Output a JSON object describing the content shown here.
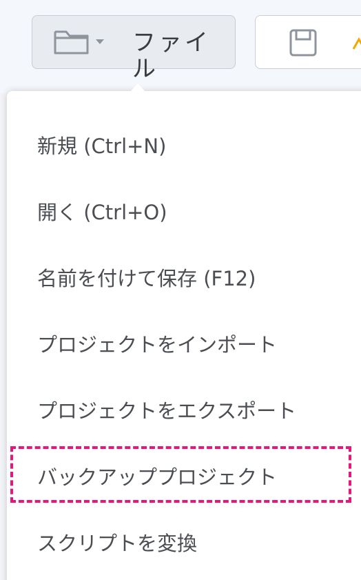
{
  "toolbar": {
    "file_button_label": "ファイル",
    "file_icon": "folder-icon",
    "save_icon": "save-icon",
    "accent_color": "#f2a900"
  },
  "file_menu": {
    "items": [
      {
        "label": "新規 (Ctrl+N)"
      },
      {
        "label": "開く (Ctrl+O)"
      },
      {
        "label": "名前を付けて保存 (F12)"
      },
      {
        "label": "プロジェクトをインポート"
      },
      {
        "label": "プロジェクトをエクスポート"
      },
      {
        "label": "バックアッププロジェクト"
      },
      {
        "label": "スクリプトを変換"
      }
    ],
    "highlighted_item": "バックアッププロジェクト",
    "highlight_color": "#e8157a"
  }
}
